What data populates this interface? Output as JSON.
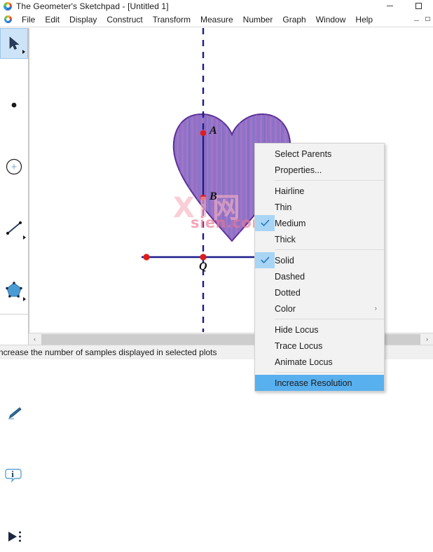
{
  "window": {
    "title": "The Geometer's Sketchpad - [Untitled 1]",
    "app_icon": "sketchpad-logo-icon",
    "minimize_label": "minimize",
    "maximize_label": "maximize"
  },
  "menubar": {
    "items": [
      {
        "label": "File"
      },
      {
        "label": "Edit"
      },
      {
        "label": "Display"
      },
      {
        "label": "Construct"
      },
      {
        "label": "Transform"
      },
      {
        "label": "Measure"
      },
      {
        "label": "Number"
      },
      {
        "label": "Graph"
      },
      {
        "label": "Window"
      },
      {
        "label": "Help"
      }
    ],
    "mdi_minimize": "_",
    "mdi_restore": "restore"
  },
  "toolbar": {
    "tools": [
      {
        "name": "arrow-select-tool",
        "icon": "arrow-icon",
        "selected": true,
        "has_flyout": true
      },
      {
        "name": "point-tool",
        "icon": "point-icon",
        "selected": false,
        "has_flyout": false
      },
      {
        "name": "compass-circle-tool",
        "icon": "circle-icon",
        "selected": false,
        "has_flyout": false
      },
      {
        "name": "straightedge-tool",
        "icon": "line-segment-icon",
        "selected": false,
        "has_flyout": true
      },
      {
        "name": "polygon-tool",
        "icon": "pentagon-icon",
        "selected": false,
        "has_flyout": true
      },
      {
        "name": "text-tool",
        "icon": "letter-a-icon",
        "selected": false,
        "has_flyout": false
      },
      {
        "name": "marker-tool",
        "icon": "pencil-icon",
        "selected": false,
        "has_flyout": false
      },
      {
        "name": "information-tool",
        "icon": "info-bubble-icon",
        "selected": false,
        "has_flyout": false
      },
      {
        "name": "custom-tools",
        "icon": "play-triangle-icon",
        "selected": false,
        "has_flyout": false
      }
    ]
  },
  "canvas": {
    "watermark_top": "XI网",
    "watermark_bottom": "sien.com",
    "labels": {
      "point_a": "A",
      "point_b": "B",
      "point_q": "Q"
    },
    "colors": {
      "locus_fill": "#8e76c8",
      "locus_stripe": "#a06ec4",
      "locus_outline": "#5a2d91",
      "line": "#1a1a8c",
      "point": "#e01b1b"
    }
  },
  "context_menu": {
    "items": [
      {
        "label": "Select Parents",
        "checked": false,
        "submenu": false,
        "highlight": false,
        "separator_after": false
      },
      {
        "label": "Properties...",
        "checked": false,
        "submenu": false,
        "highlight": false,
        "separator_after": true
      },
      {
        "label": "Hairline",
        "checked": false,
        "submenu": false,
        "highlight": false,
        "separator_after": false
      },
      {
        "label": "Thin",
        "checked": false,
        "submenu": false,
        "highlight": false,
        "separator_after": false
      },
      {
        "label": "Medium",
        "checked": true,
        "submenu": false,
        "highlight": false,
        "separator_after": false
      },
      {
        "label": "Thick",
        "checked": false,
        "submenu": false,
        "highlight": false,
        "separator_after": true
      },
      {
        "label": "Solid",
        "checked": true,
        "submenu": false,
        "highlight": false,
        "separator_after": false
      },
      {
        "label": "Dashed",
        "checked": false,
        "submenu": false,
        "highlight": false,
        "separator_after": false
      },
      {
        "label": "Dotted",
        "checked": false,
        "submenu": false,
        "highlight": false,
        "separator_after": false
      },
      {
        "label": "Color",
        "checked": false,
        "submenu": true,
        "highlight": false,
        "separator_after": true
      },
      {
        "label": "Hide Locus",
        "checked": false,
        "submenu": false,
        "highlight": false,
        "separator_after": false
      },
      {
        "label": "Trace Locus",
        "checked": false,
        "submenu": false,
        "highlight": false,
        "separator_after": false
      },
      {
        "label": "Animate Locus",
        "checked": false,
        "submenu": false,
        "highlight": false,
        "separator_after": true
      },
      {
        "label": "Increase Resolution",
        "checked": false,
        "submenu": false,
        "highlight": true,
        "separator_after": false
      }
    ],
    "submenu_arrow": "›",
    "highlight_color": "#58b0ef",
    "check_color": "#2b7cc4"
  },
  "scrollbar": {
    "left_arrow": "‹",
    "right_arrow": "›"
  },
  "statusbar": {
    "text": "ncrease the number of samples displayed in selected plots"
  }
}
